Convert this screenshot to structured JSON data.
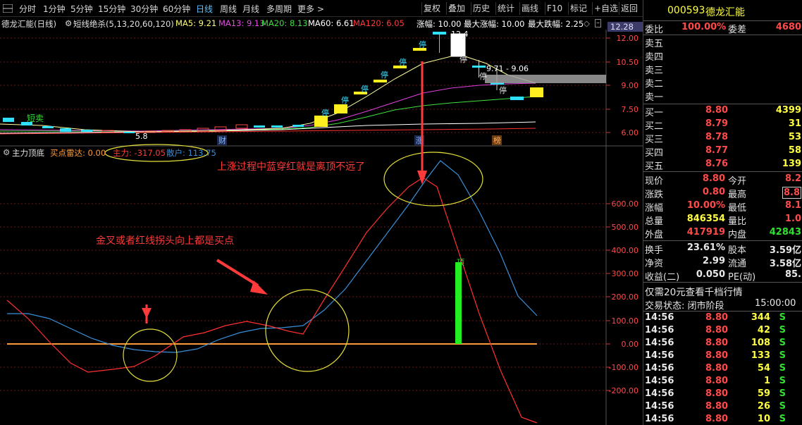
{
  "toolbar": {
    "periods": [
      "分时",
      "1分钟",
      "5分钟",
      "15分钟",
      "30分钟",
      "60分钟",
      "日线",
      "周线",
      "月线",
      "多周期",
      "更多 >"
    ],
    "active_period": "日线",
    "right_buttons": [
      "复权",
      "叠加",
      "历史",
      "统计",
      "画线",
      "F10",
      "标记",
      "+自选",
      "返回"
    ]
  },
  "kline_info": {
    "stock_title": "德龙汇能(日线)",
    "indicator_name": "短线绝杀(5,13,20,60,120)",
    "ma5": "MA5: 9.21",
    "ma13": "MA13: 9.13",
    "ma20": "MA20: 8.13",
    "ma60": "MA60: 6.61",
    "ma120": "MA120: 6.05",
    "change_pct": "涨幅: 10.00",
    "max_up": "最大涨幅: 10.00",
    "max_down": "最大跌幅: 2.25",
    "price_tag": "12.28"
  },
  "price_axis": [
    "12.00",
    "10.50",
    "9.00",
    "7.50",
    "6.00"
  ],
  "candle_labels": {
    "high_label": "12.4",
    "low_label": "5.8",
    "range_label": "9.71 - 9.06",
    "stop_marks": [
      "停",
      "停",
      "停",
      "停",
      "停",
      "停",
      "停",
      "停",
      "停"
    ],
    "short_sell": "短卖",
    "bottom_tags": [
      "财",
      "涨",
      "榜"
    ]
  },
  "sub_info": {
    "name": "主力顶底",
    "buy_radar": "买点雷达: 0.00",
    "main_force": "主力: -317.05",
    "retail": "散户: 113.75"
  },
  "sub_axis": [
    "600.00",
    "500.00",
    "400.00",
    "300.00",
    "200.00",
    "100.00",
    "0.00",
    "-100.00",
    "-200.00"
  ],
  "annotations": {
    "text_top": "上涨过程中蓝穿红就是离顶不远了",
    "text_left": "金叉或者红线拐头向上都是买点",
    "top_marker": "顶"
  },
  "quote": {
    "code": "000593",
    "name": "德龙汇能",
    "weibi_label": "委比",
    "weibi_value": "100.00%",
    "weicha_label": "委差",
    "weicha_value": "4680",
    "sells": [
      {
        "label": "卖五",
        "price": "",
        "vol": ""
      },
      {
        "label": "卖四",
        "price": "",
        "vol": ""
      },
      {
        "label": "卖三",
        "price": "",
        "vol": ""
      },
      {
        "label": "卖二",
        "price": "",
        "vol": ""
      },
      {
        "label": "卖一",
        "price": "",
        "vol": ""
      }
    ],
    "buys": [
      {
        "label": "买一",
        "price": "8.80",
        "vol": "4399"
      },
      {
        "label": "买二",
        "price": "8.79",
        "vol": "31"
      },
      {
        "label": "买三",
        "price": "8.78",
        "vol": "53"
      },
      {
        "label": "买四",
        "price": "8.77",
        "vol": "58"
      },
      {
        "label": "买五",
        "price": "8.76",
        "vol": "139"
      }
    ],
    "stats": [
      {
        "l1": "现价",
        "v1": "8.80",
        "l2": "今开",
        "v2": "8.2"
      },
      {
        "l1": "涨跌",
        "v1": "0.80",
        "l2": "最高",
        "v2": "8.8"
      },
      {
        "l1": "涨幅",
        "v1": "10.00%",
        "l2": "最低",
        "v2": "8.1"
      },
      {
        "l1": "总量",
        "v1": "846354",
        "l2": "量比",
        "v2": "1.0"
      },
      {
        "l1": "外盘",
        "v1": "417919",
        "l2": "内盘",
        "v2": "42843"
      }
    ],
    "stats2": [
      {
        "l1": "换手",
        "v1": "23.61%",
        "l2": "股本",
        "v2": "3.59亿"
      },
      {
        "l1": "净资",
        "v1": "2.99",
        "l2": "流通",
        "v2": "3.58亿"
      },
      {
        "l1": "收益(二)",
        "v1": "0.050",
        "l2": "PE(动)",
        "v2": "85."
      }
    ],
    "promo": "仅需20元查看千档行情",
    "trade_state_label": "交易状态: 闭市阶段",
    "trade_time": "15:00:00",
    "ticks": [
      {
        "time": "14:56",
        "price": "8.80",
        "vol": "344",
        "side": "S"
      },
      {
        "time": "14:56",
        "price": "8.80",
        "vol": "42",
        "side": "S"
      },
      {
        "time": "14:56",
        "price": "8.80",
        "vol": "108",
        "side": "S"
      },
      {
        "time": "14:56",
        "price": "8.80",
        "vol": "133",
        "side": "S"
      },
      {
        "time": "14:56",
        "price": "8.80",
        "vol": "54",
        "side": "S"
      },
      {
        "time": "14:56",
        "price": "8.80",
        "vol": "1",
        "side": "S"
      },
      {
        "time": "14:56",
        "price": "8.80",
        "vol": "59",
        "side": "S"
      },
      {
        "time": "14:56",
        "price": "8.80",
        "vol": "26",
        "side": "S"
      },
      {
        "time": "14:56",
        "price": "8.80",
        "vol": "10",
        "side": "S"
      }
    ]
  },
  "colors": {
    "up": "#ff4a4a",
    "down": "#30e030",
    "ma5": "#ffffa0",
    "ma13": "#e040e0",
    "ma20": "#40e040",
    "ma60": "#ffffff",
    "ma120": "#ff3030",
    "main_line": "#ff3030",
    "retail_line": "#3a8fd8",
    "zero_line": "#ff9a3a",
    "annotation": "#ff3a3a",
    "circle": "#e6e03a"
  }
}
